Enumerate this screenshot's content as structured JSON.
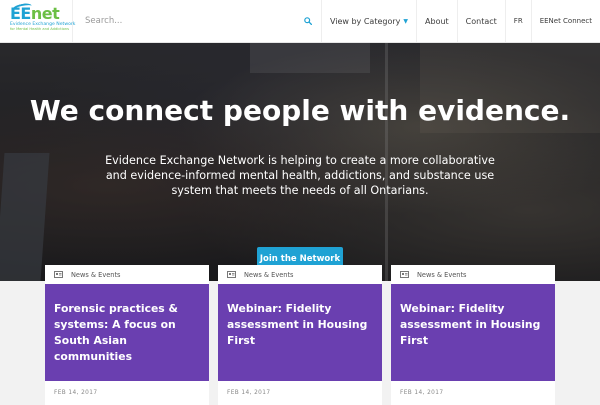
{
  "header": {
    "logo": {
      "mark_ee": "EE",
      "mark_net": "net",
      "subtitle_1": "Evidence Exchange Network",
      "subtitle_2": "for Mental Health and Addictions"
    },
    "search": {
      "placeholder": "Search...",
      "icon": "search-icon"
    },
    "nav": [
      {
        "label": "View by Category"
      },
      {
        "label": "About"
      },
      {
        "label": "Contact"
      },
      {
        "label": "FR"
      },
      {
        "label": "EENet Connect"
      }
    ]
  },
  "hero": {
    "title": "We connect people with evidence.",
    "text": "Evidence Exchange Network is helping to create a more collaborative and evidence-informed mental health, addictions, and substance use system that meets the needs of all Ontarians.",
    "button_label": "Join the Network"
  },
  "cards": [
    {
      "category": "News & Events",
      "title": "Forensic practices & systems: A focus on South Asian communities",
      "date": "FEB 14, 2017"
    },
    {
      "category": "News & Events",
      "title": "Webinar: Fidelity assessment in Housing First",
      "date": "FEB 14, 2017"
    },
    {
      "category": "News & Events",
      "title": "Webinar: Fidelity assessment in Housing First",
      "date": "FEB 14, 2017"
    }
  ],
  "colors": {
    "accent_blue": "#1fa2d4",
    "accent_green": "#6cbf45",
    "card_purple": "#6a3fb0"
  }
}
